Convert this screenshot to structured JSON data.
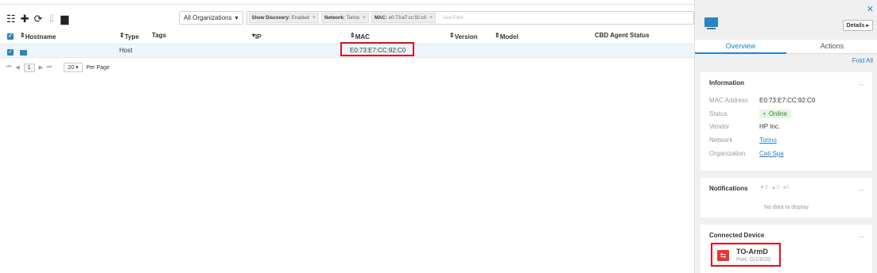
{
  "toolbar": {
    "icons": [
      "grid-icon",
      "plus-icon",
      "refresh-icon",
      "download-icon",
      "trash-icon"
    ]
  },
  "filters": {
    "org_select": "All Organizations",
    "chips": [
      {
        "label": "Show Discovery:",
        "value": "Enabled"
      },
      {
        "label": "Network:",
        "value": "Torino"
      },
      {
        "label": "MAC:",
        "value": "e0:73:e7:cc:92:c0"
      }
    ],
    "add_placeholder": "Add Filter"
  },
  "table": {
    "columns": {
      "hostname": "Hostname",
      "type": "Type",
      "tags": "Tags",
      "ip": "IP",
      "mac": "MAC",
      "version": "Version",
      "model": "Model",
      "cbd": "CBD Agent Status"
    },
    "rows": [
      {
        "type": "Host",
        "mac": "E0:73:E7:CC:92:C0"
      }
    ]
  },
  "pager": {
    "first": "⏮",
    "prev": "◀",
    "page": "1",
    "next": "▶",
    "last": "⏭",
    "per_page_value": "20",
    "per_page_label": "Per Page"
  },
  "panel": {
    "details_button": "Details",
    "tabs": {
      "overview": "Overview",
      "actions": "Actions"
    },
    "fold_all": "Fold All",
    "information": {
      "title": "Information",
      "rows": [
        {
          "label": "MAC Address",
          "value": "E0:73:E7:CC:92:C0"
        },
        {
          "label": "Status",
          "value": "Online"
        },
        {
          "label": "Vendor",
          "value": "HP Inc."
        },
        {
          "label": "Network",
          "value": "Torino"
        },
        {
          "label": "Organization",
          "value": "Cati Spa"
        }
      ]
    },
    "notifications": {
      "title": "Notifications",
      "counts": {
        "error": "0",
        "warning": "0",
        "info": "0"
      },
      "empty": "No data to display"
    },
    "connected_device": {
      "title": "Connected Device",
      "name": "TO-ArmD",
      "port": "Port: Gi1/0/20"
    }
  },
  "colors": {
    "accent": "#2a83c6",
    "highlight": "#e0101a",
    "device": "#e9352d"
  }
}
